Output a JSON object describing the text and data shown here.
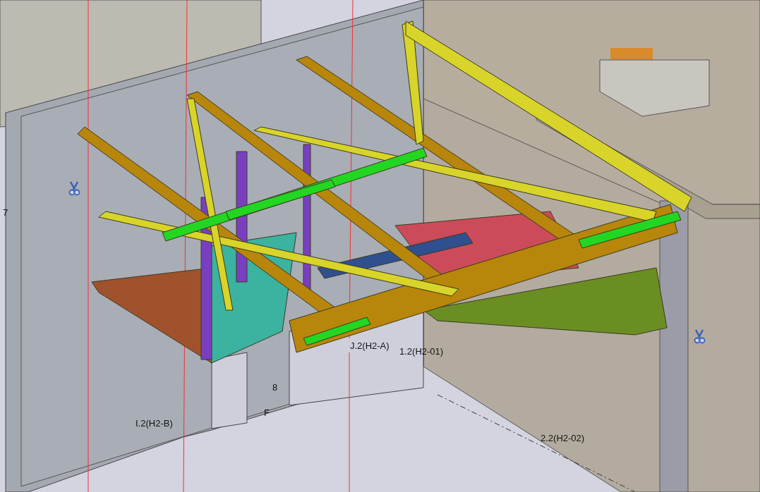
{
  "viewport": {
    "grid_labels": [
      {
        "text": "7"
      },
      {
        "text": "J.2(H2-A)"
      },
      {
        "text": "1.2(H2-01)"
      },
      {
        "text": "8"
      },
      {
        "text": "F"
      },
      {
        "text": "I.2(H2-B)"
      },
      {
        "text": "2.2(H2-02)"
      }
    ]
  }
}
